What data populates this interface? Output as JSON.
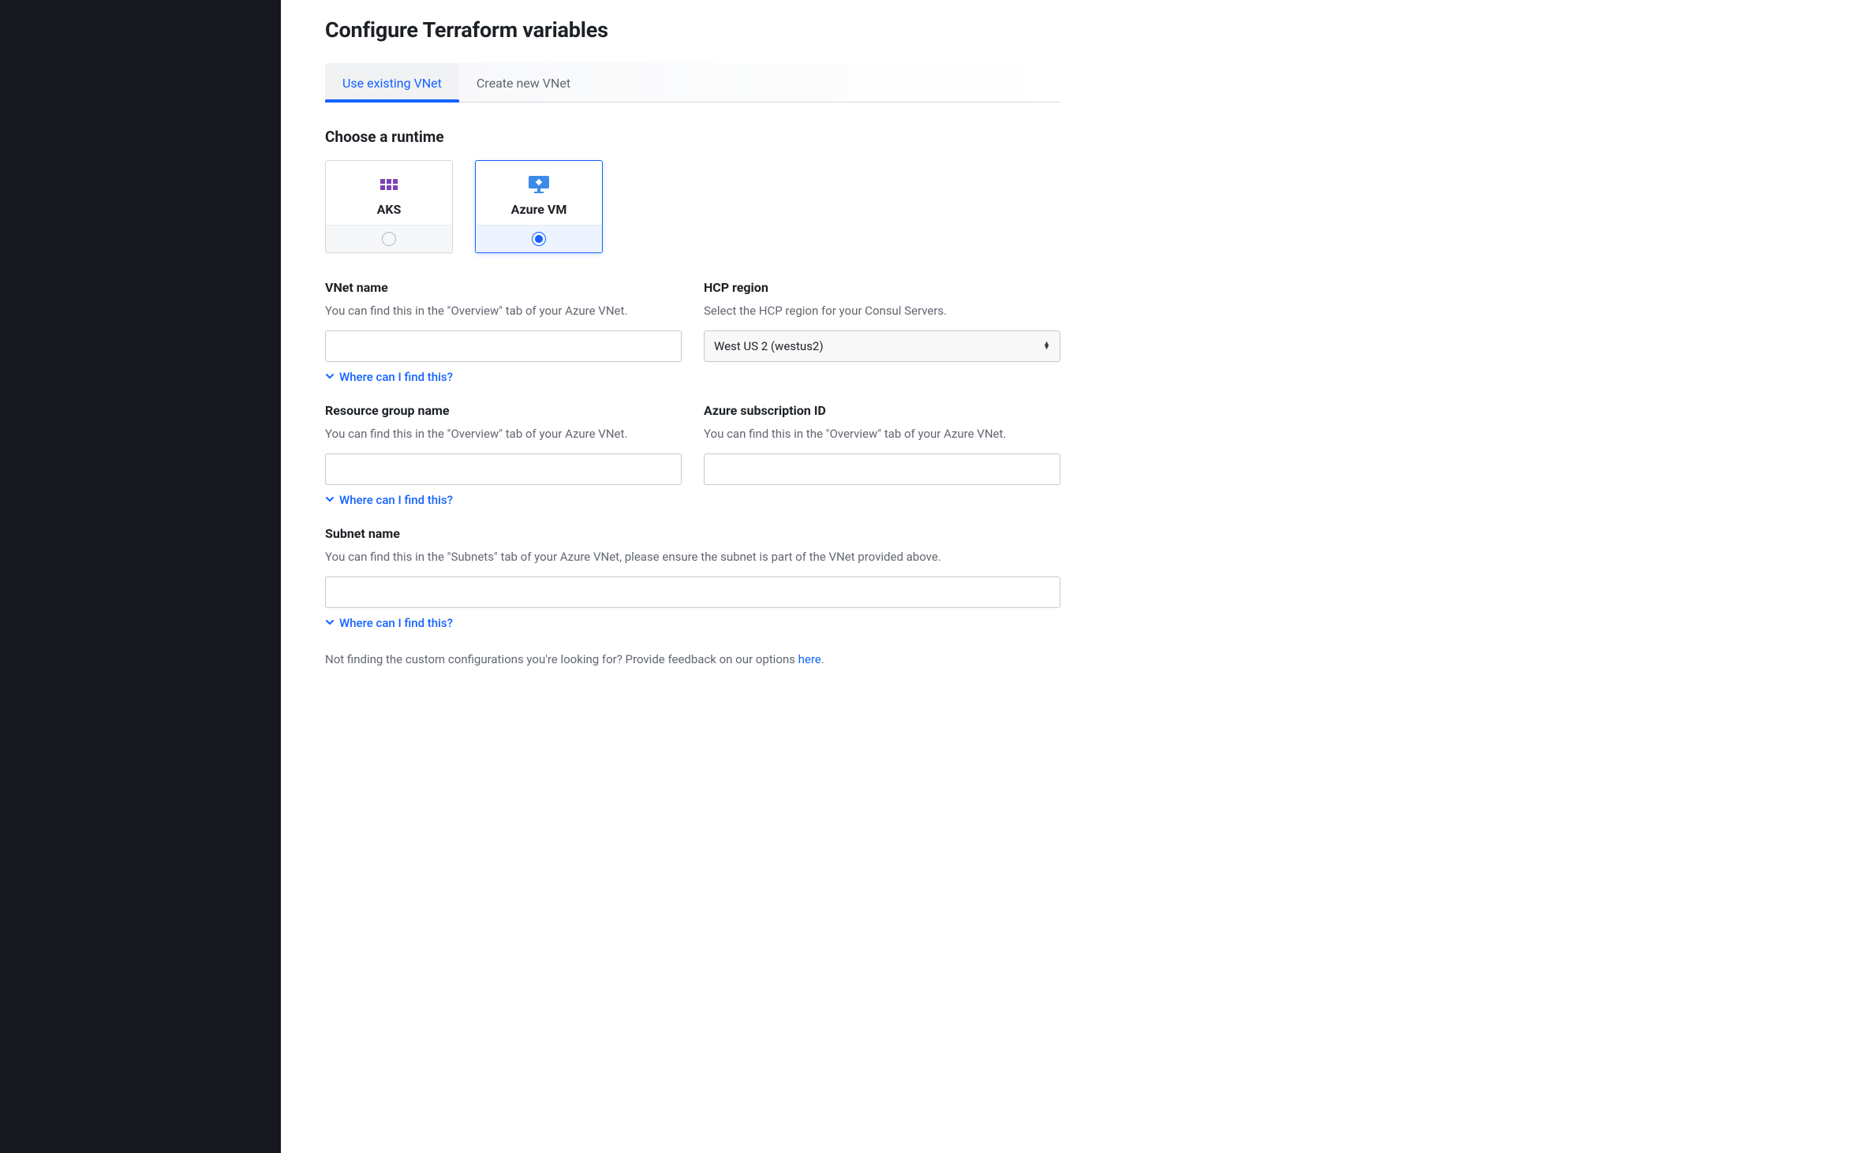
{
  "page": {
    "title": "Configure Terraform variables"
  },
  "tabs": [
    {
      "label": "Use existing VNet",
      "active": true
    },
    {
      "label": "Create new VNet",
      "active": false
    }
  ],
  "runtime": {
    "title": "Choose a runtime",
    "options": [
      {
        "id": "aks",
        "label": "AKS",
        "selected": false,
        "icon": "aks-icon"
      },
      {
        "id": "azure-vm",
        "label": "Azure VM",
        "selected": true,
        "icon": "azure-vm-icon"
      }
    ]
  },
  "fields": {
    "vnet_name": {
      "label": "VNet name",
      "help": "You can find this in the \"Overview\" tab of your Azure VNet.",
      "value": "",
      "disclose": "Where can I find this?"
    },
    "hcp_region": {
      "label": "HCP region",
      "help": "Select the HCP region for your Consul Servers.",
      "selected": "West US 2 (westus2)"
    },
    "resource_group": {
      "label": "Resource group name",
      "help": "You can find this in the \"Overview\" tab of your Azure VNet.",
      "value": "",
      "disclose": "Where can I find this?"
    },
    "subscription_id": {
      "label": "Azure subscription ID",
      "help": "You can find this in the \"Overview\" tab of your Azure VNet.",
      "value": ""
    },
    "subnet_name": {
      "label": "Subnet name",
      "help": "You can find this in the \"Subnets\" tab of your Azure VNet, please ensure the subnet is part of the VNet provided above.",
      "value": "",
      "disclose": "Where can I find this?"
    }
  },
  "feedback": {
    "prefix": "Not finding the custom configurations you're looking for? Provide feedback on our options ",
    "link": "here",
    "suffix": "."
  }
}
